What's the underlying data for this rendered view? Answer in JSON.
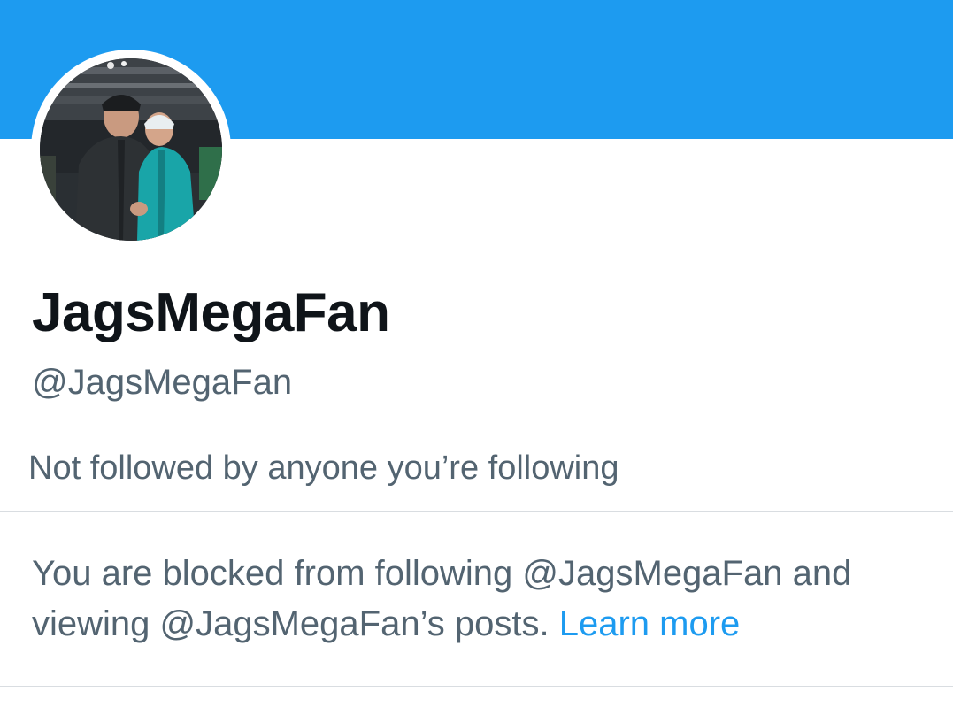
{
  "profile": {
    "banner_color": "#1d9bf0",
    "avatar_description": "avatar",
    "display_name": "JagsMegaFan",
    "handle": "@JagsMegaFan",
    "followers_you_know": "Not followed by anyone you’re following"
  },
  "blocked_notice": {
    "line_1": "You are blocked from following @JagsMegaFan and",
    "line_2": "viewing @JagsMegaFan’s posts.",
    "learn_more": "Learn more",
    "link_color": "#1d9bf0"
  }
}
